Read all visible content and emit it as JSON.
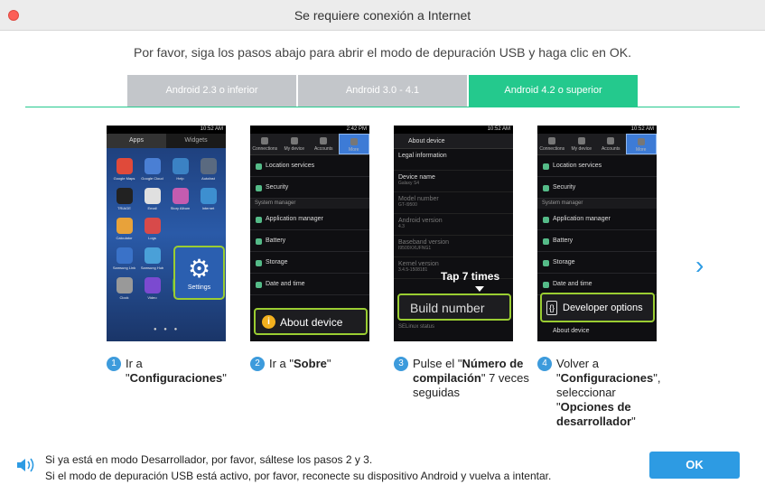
{
  "window": {
    "title": "Se requiere conexión a Internet"
  },
  "instruction": "Por favor, siga los pasos abajo para abrir el modo de depuración USB y haga clic en OK.",
  "tabs": [
    {
      "label": "Android 2.3 o inferior"
    },
    {
      "label": "Android 3.0 - 4.1"
    },
    {
      "label": "Android 4.2 o superior"
    }
  ],
  "colors": {
    "accent": "#24c98d",
    "blue": "#2d9be3",
    "highlight": "#9acd32"
  },
  "phone1": {
    "time": "10:52 AM",
    "tabs": [
      "Apps",
      "Widgets"
    ],
    "apps": [
      "Google Maps",
      "Google Cloud",
      "Help",
      "Autofast",
      "TRIAGE",
      "Email",
      "Story Album",
      "Internet",
      "Calculator",
      "Logs",
      "",
      "",
      "Samsung Link",
      "Samsung Hub",
      "",
      "",
      "Clock",
      "Video",
      "Phone",
      ""
    ],
    "settings_label": "Settings"
  },
  "phone2": {
    "time": "2:42 PM",
    "tabs": [
      "Connections",
      "My device",
      "Accounts",
      "More"
    ],
    "rows": [
      "Location services",
      "Security"
    ],
    "section": "System manager",
    "rows2": [
      "Application manager",
      "Battery",
      "Storage",
      "Date and time"
    ],
    "callout": "About device"
  },
  "phone3": {
    "time": "10:52 AM",
    "header": "About device",
    "items": [
      {
        "t": "Legal information",
        "s": ""
      },
      {
        "t": "Device name",
        "s": "Galaxy S4"
      },
      {
        "t": "Model number",
        "s": "GT-I9500"
      },
      {
        "t": "Android version",
        "s": "4.3"
      },
      {
        "t": "Baseband version",
        "s": "I9500XXUFNG1"
      },
      {
        "t": "Kernel version",
        "s": "3.4.5-1508181"
      }
    ],
    "tap_label": "Tap 7 times",
    "callout": "Build number",
    "bottom": "SELinux status"
  },
  "phone4": {
    "time": "10:52 AM",
    "tabs": [
      "Connections",
      "My device",
      "Accounts",
      "More"
    ],
    "rows": [
      "Location services",
      "Security"
    ],
    "section": "System manager",
    "rows2": [
      "Application manager",
      "Battery",
      "Storage",
      "Date and time"
    ],
    "callout": "Developer options",
    "bottom": "About device"
  },
  "steps": [
    {
      "num": "1",
      "pre": "Ir a \"",
      "bold": "Configuraciones",
      "post": "\""
    },
    {
      "num": "2",
      "pre": "Ir a \"",
      "bold": "Sobre",
      "post": "\""
    },
    {
      "num": "3",
      "pre": "Pulse el \"",
      "bold": "Número de compilación",
      "post": "\" 7 veces seguidas"
    },
    {
      "num": "4",
      "pre": "Volver a \"",
      "bold": "Configuraciones",
      "mid": "\", seleccionar \"",
      "bold2": "Opciones de desarrollador",
      "post": "\""
    }
  ],
  "footer": {
    "line1": "Si ya está en modo Desarrollador, por favor, sáltese los pasos 2 y 3.",
    "line2": "Si el modo de depuración USB está activo, por favor, reconecte su dispositivo Android y vuelva a intentar."
  },
  "ok_label": "OK"
}
